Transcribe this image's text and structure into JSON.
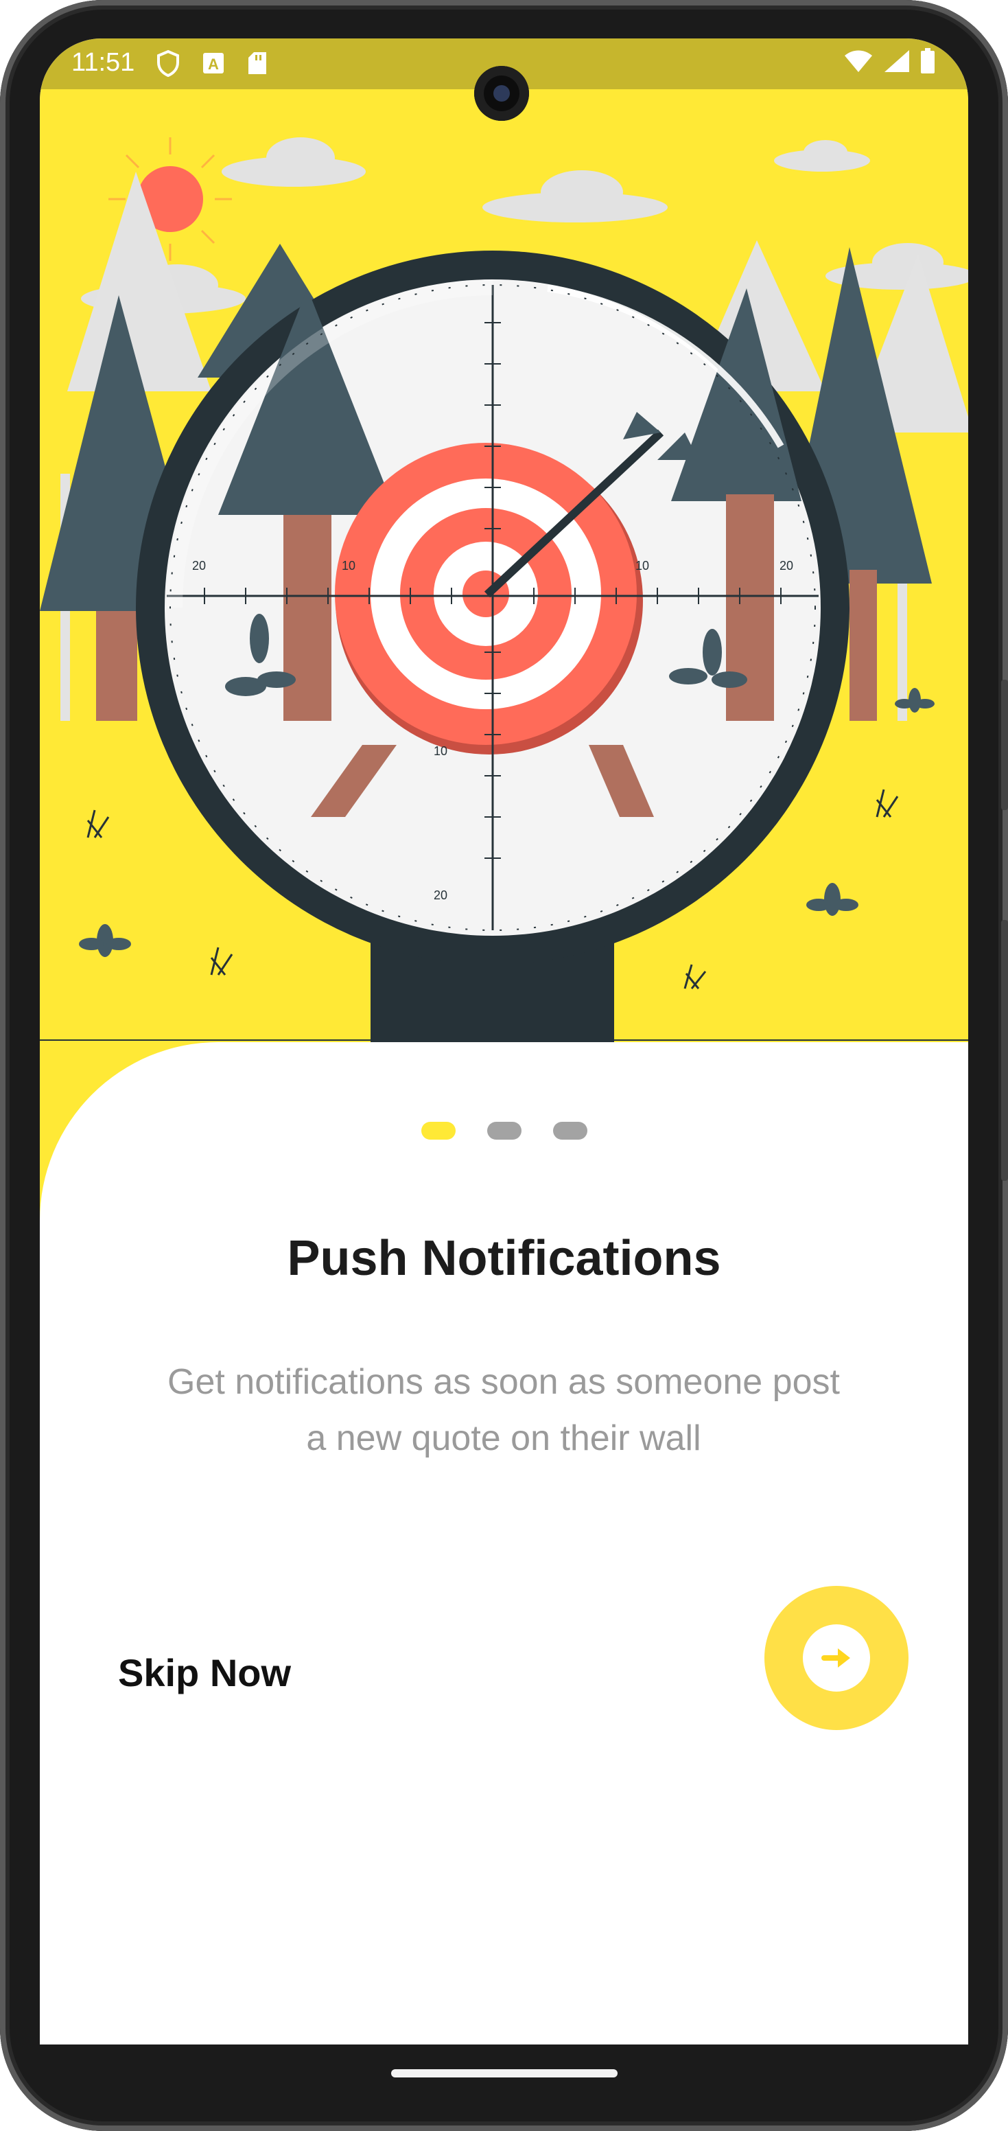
{
  "status_bar": {
    "time": "11:51",
    "left_icons": [
      "shield-icon",
      "keyboard-a-icon",
      "sd-card-icon"
    ],
    "right_icons": [
      "wifi-icon",
      "signal-icon",
      "battery-icon"
    ],
    "color": "#c6b62d"
  },
  "illustration": {
    "scope_labels": [
      "20",
      "10",
      "10",
      "20",
      "10",
      "20"
    ],
    "background_color": "#ffe936",
    "target_color": "#ff6b59",
    "frame_color": "#263238"
  },
  "onboarding": {
    "page_count": 3,
    "active_page": 1,
    "title": "Push Notifications",
    "description": "Get notifications as soon as someone post a new quote on their wall",
    "skip_label": "Skip Now",
    "next_icon": "arrow-right-icon"
  },
  "colors": {
    "accent": "#ffe047",
    "dot_inactive": "#a3a3a3",
    "title": "#1c1c1c",
    "description": "#9a9a9a"
  }
}
